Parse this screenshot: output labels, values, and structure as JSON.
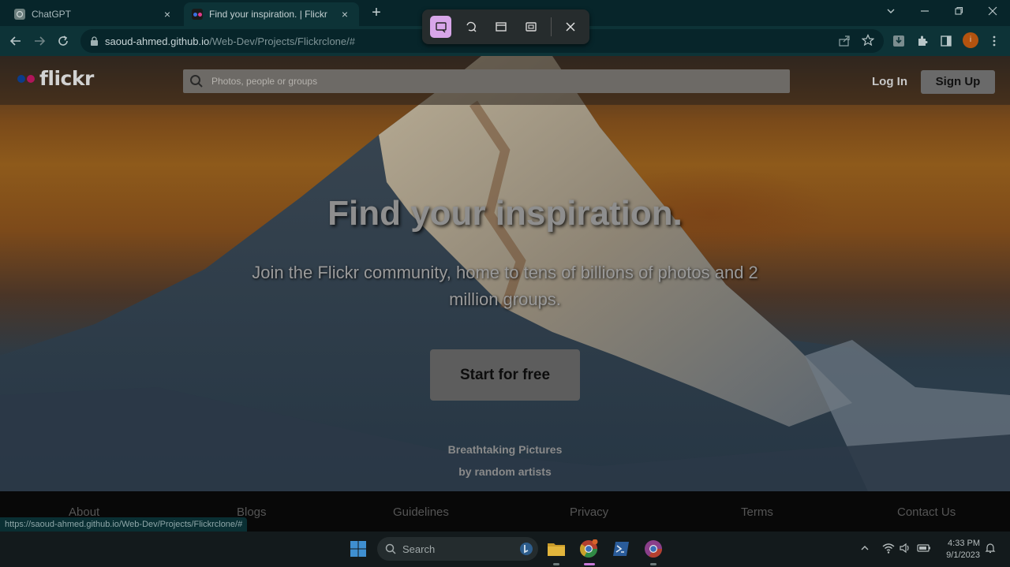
{
  "browser": {
    "tabs": [
      {
        "title": "ChatGPT"
      },
      {
        "title": "Find your inspiration. | Flickr"
      }
    ],
    "tab_close_glyph": "×",
    "new_tab_glyph": "+",
    "url_host": "saoud-ahmed.github.io",
    "url_path": "/Web-Dev/Projects/Flickrclone/#",
    "profile_initial": "i",
    "status_url": "https://saoud-ahmed.github.io/Web-Dev/Projects/Flickrclone/#"
  },
  "page": {
    "logo_text": "flickr",
    "logo_colors": [
      "#0b3c8a",
      "#b0155a"
    ],
    "search_placeholder": "Photos, people or groups",
    "login_label": "Log In",
    "signup_label": "Sign Up",
    "hero_title": "Find your inspiration.",
    "hero_subtitle": "Join the Flickr community, home to tens of billions of photos and 2 million groups.",
    "cta_label": "Start for free",
    "credit_line1": "Breathtaking Pictures",
    "credit_line2": "by random artists",
    "footer_links": [
      "About",
      "Blogs",
      "Guidelines",
      "Privacy",
      "Terms",
      "Contact Us"
    ]
  },
  "taskbar": {
    "search_label": "Search",
    "time": "4:33 PM",
    "date": "9/1/2023"
  },
  "icons": {
    "snip": [
      "rectangle-snip-icon",
      "freeform-snip-icon",
      "window-snip-icon",
      "fullscreen-snip-icon",
      "close-icon"
    ],
    "accent": "#d8a6e9"
  }
}
